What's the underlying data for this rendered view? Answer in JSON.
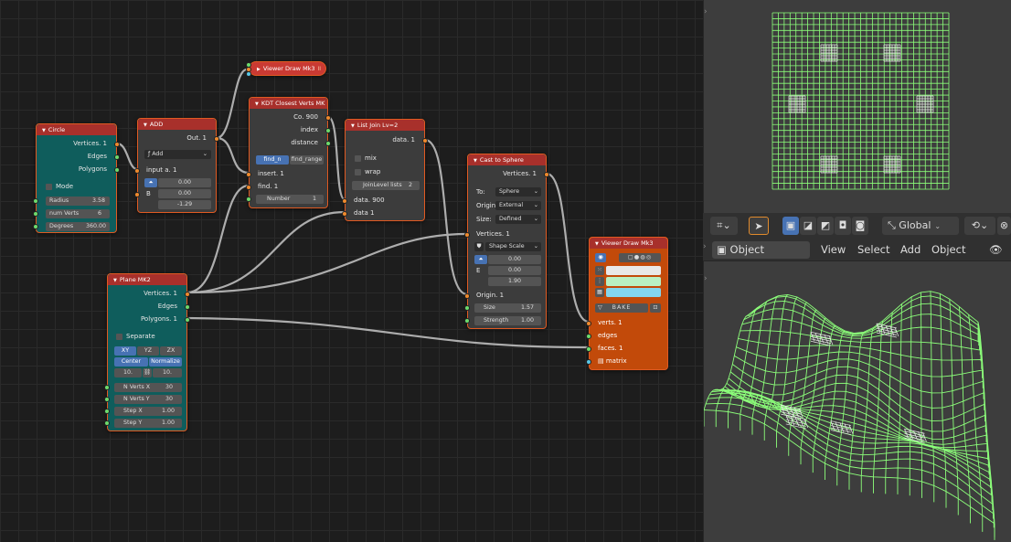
{
  "nodes": {
    "circle": {
      "title": "Circle",
      "outputs": [
        "Vertices. 1",
        "Edges",
        "Polygons"
      ],
      "mode_label": "Mode",
      "fields": [
        {
          "label": "Radius",
          "value": "3.58"
        },
        {
          "label": "num Verts",
          "value": "6"
        },
        {
          "label": "Degrees",
          "value": "360.00"
        }
      ]
    },
    "add": {
      "title": "ADD",
      "output": "Out. 1",
      "op": "Add",
      "input_a": "input a. 1",
      "b_label": "B",
      "values": [
        "0.00",
        "0.00",
        "-1.29"
      ]
    },
    "viewer_top": {
      "title": "Viewer Draw Mk3",
      "pause": "II"
    },
    "kdt": {
      "title": "KDT Closest Verts MK",
      "outputs": [
        "Co. 900",
        "index",
        "distance"
      ],
      "modes": [
        "find_n",
        "find_range"
      ],
      "inputs": [
        "insert. 1",
        "find. 1"
      ],
      "number_label": "Number",
      "number_value": "1"
    },
    "list_join": {
      "title": "List Join Lv=2",
      "output": "data. 1",
      "mix": "mix",
      "wrap": "wrap",
      "join_label": "JoinLevel lists",
      "join_value": "2",
      "inputs": [
        "data. 900",
        "data 1"
      ]
    },
    "cast": {
      "title": "Cast to Sphere",
      "output": "Vertices. 1",
      "to_label": "To:",
      "to_value": "Sphere",
      "origin_label": "Origin:",
      "origin_value": "External",
      "size_label": "Size:",
      "size_value": "Defined",
      "vertices_in": "Vertices. 1",
      "shape_scale": "Shape Scale",
      "e_label": "E",
      "values": [
        "0.00",
        "0.00",
        "1.90"
      ],
      "origin_in": "Origin. 1",
      "size_field": "Size",
      "size_field_value": "1.57",
      "strength_field": "Strength",
      "strength_value": "1.00"
    },
    "plane": {
      "title": "Plane MK2",
      "outputs": [
        "Vertices. 1",
        "Edges",
        "Polygons. 1"
      ],
      "separate": "Separate",
      "planes": [
        "XY",
        "YZ",
        "ZX"
      ],
      "center": "Center",
      "normalize": "Normalize",
      "size_a": "10.",
      "size_b": "10.",
      "fields": [
        {
          "label": "N Verts X",
          "value": "30"
        },
        {
          "label": "N Verts Y",
          "value": "30"
        },
        {
          "label": "Step X",
          "value": "1.00"
        },
        {
          "label": "Step Y",
          "value": "1.00"
        }
      ]
    },
    "viewer_main": {
      "title": "Viewer Draw Mk3",
      "bake": "BAKE",
      "inputs": [
        "verts. 1",
        "edges",
        "faces. 1",
        "matrix"
      ],
      "swatches": [
        "#e8e8e8",
        "#b9f0c3",
        "#84d6ee"
      ]
    }
  },
  "viewport": {
    "transform_orientation": "Global",
    "mode": "Object Mode",
    "menus": [
      "View",
      "Select",
      "Add",
      "Object"
    ]
  },
  "colors": {
    "mesh": "#8cff7a",
    "node_header": "#a8302b",
    "teal_node": "#0f5d5c",
    "orange_node": "#c24a0a",
    "link": "#bdbdbd"
  }
}
